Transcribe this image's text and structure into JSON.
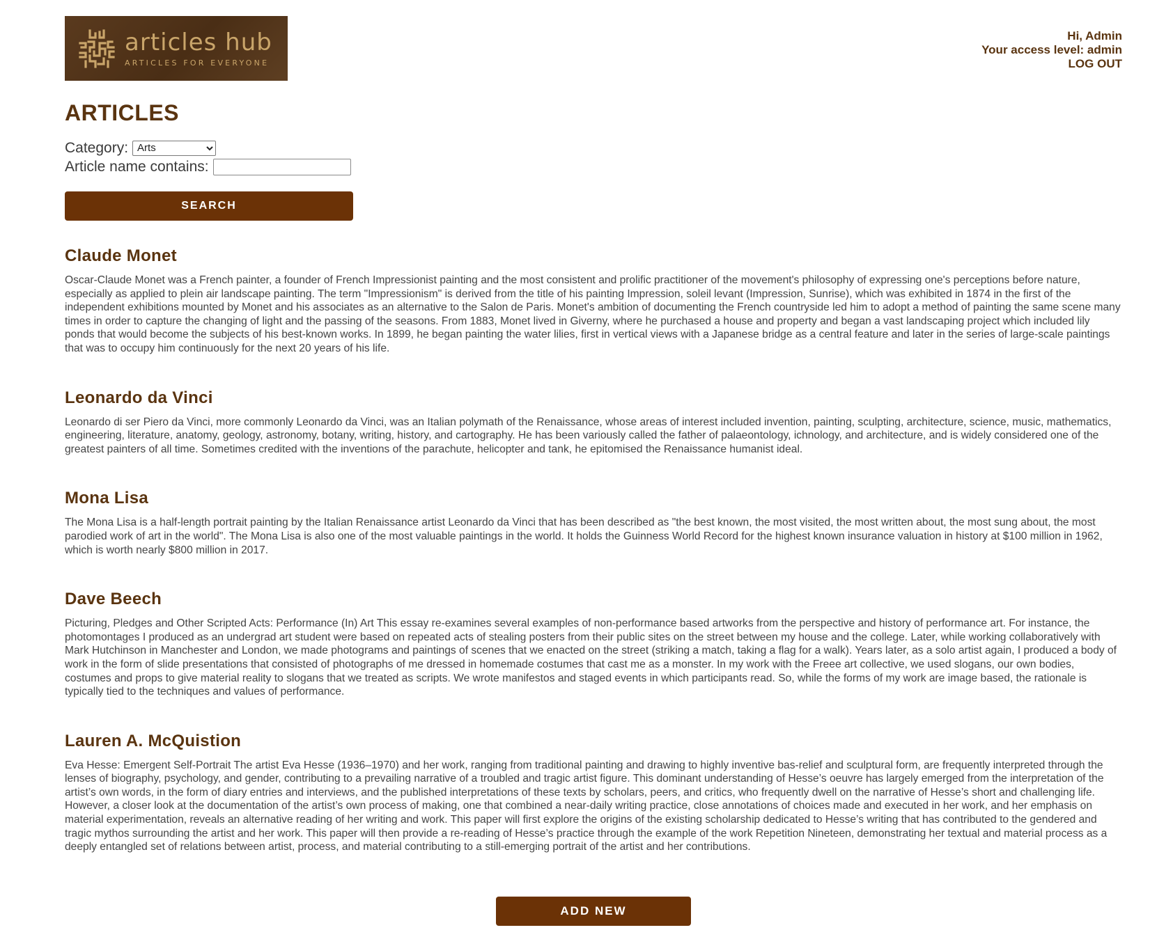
{
  "brand": {
    "title": "articles hub",
    "tagline": "ARTICLES FOR EVERYONE",
    "logo_icon": "maze-knot-icon",
    "colors": {
      "logo_bg": "#4f3119",
      "logo_text": "#c9a56a",
      "accent": "#6b3206",
      "heading": "#5a3410"
    }
  },
  "user": {
    "greeting": "Hi, Admin",
    "access_level": "Your access level: admin",
    "logout_label": "LOG OUT"
  },
  "page": {
    "title": "ARTICLES"
  },
  "filters": {
    "category_label": "Category:",
    "category_selected": "Arts",
    "name_label": "Article name contains:",
    "name_value": "",
    "search_label": "SEARCH"
  },
  "articles": [
    {
      "title": "Claude Monet",
      "body": "Oscar-Claude Monet was a French painter, a founder of French Impressionist painting and the most consistent and prolific practitioner of the movement's philosophy of expressing one's perceptions before nature, especially as applied to plein air landscape painting. The term \"Impressionism\" is derived from the title of his painting Impression, soleil levant (Impression, Sunrise), which was exhibited in 1874 in the first of the independent exhibitions mounted by Monet and his associates as an alternative to the Salon de Paris. Monet's ambition of documenting the French countryside led him to adopt a method of painting the same scene many times in order to capture the changing of light and the passing of the seasons. From 1883, Monet lived in Giverny, where he purchased a house and property and began a vast landscaping project which included lily ponds that would become the subjects of his best-known works. In 1899, he began painting the water lilies, first in vertical views with a Japanese bridge as a central feature and later in the series of large-scale paintings that was to occupy him continuously for the next 20 years of his life."
    },
    {
      "title": "Leonardo da Vinci",
      "body": "Leonardo di ser Piero da Vinci, more commonly Leonardo da Vinci, was an Italian polymath of the Renaissance, whose areas of interest included invention, painting, sculpting, architecture, science, music, mathematics, engineering, literature, anatomy, geology, astronomy, botany, writing, history, and cartography. He has been variously called the father of palaeontology, ichnology, and architecture, and is widely considered one of the greatest painters of all time. Sometimes credited with the inventions of the parachute, helicopter and tank, he epitomised the Renaissance humanist ideal."
    },
    {
      "title": "Mona Lisa",
      "body": "The Mona Lisa is a half-length portrait painting by the Italian Renaissance artist Leonardo da Vinci that has been described as \"the best known, the most visited, the most written about, the most sung about, the most parodied work of art in the world\". The Mona Lisa is also one of the most valuable paintings in the world. It holds the Guinness World Record for the highest known insurance valuation in history at $100 million in 1962, which is worth nearly $800 million in 2017."
    },
    {
      "title": "Dave Beech",
      "body": "Picturing, Pledges and Other Scripted Acts: Performance (In) Art This essay re-examines several examples of non-performance based artworks from the perspective and history of performance art. For instance, the photomontages I produced as an undergrad art student were based on repeated acts of stealing posters from their public sites on the street between my house and the college. Later, while working collaboratively with Mark Hutchinson in Manchester and London, we made photograms and paintings of scenes that we enacted on the street (striking a match, taking a flag for a walk). Years later, as a solo artist again, I produced a body of work in the form of slide presentations that consisted of photographs of me dressed in homemade costumes that cast me as a monster. In my work with the Freee art collective, we used slogans, our own bodies, costumes and props to give material reality to slogans that we treated as scripts. We wrote manifestos and staged events in which participants read. So, while the forms of my work are image based, the rationale is typically tied to the techniques and values of performance."
    },
    {
      "title": "Lauren A. McQuistion",
      "body": "Eva Hesse: Emergent Self-Portrait The artist Eva Hesse (1936–1970) and her work, ranging from traditional painting and drawing to highly inventive bas-relief and sculptural form, are frequently interpreted through the lenses of biography, psychology, and gender, contributing to a prevailing narrative of a troubled and tragic artist figure. This dominant understanding of Hesse’s oeuvre has largely emerged from the interpretation of the artist’s own words, in the form of diary entries and interviews, and the published interpretations of these texts by scholars, peers, and critics, who frequently dwell on the narrative of Hesse’s short and challenging life. However, a closer look at the documentation of the artist’s own process of making, one that combined a near-daily writing practice, close annotations of choices made and executed in her work, and her emphasis on material experimentation, reveals an alternative reading of her writing and work. This paper will first explore the origins of the existing scholarship dedicated to Hesse’s writing that has contributed to the gendered and tragic mythos surrounding the artist and her work. This paper will then provide a re-reading of Hesse’s practice through the example of the work Repetition Nineteen, demonstrating her textual and material process as a deeply entangled set of relations between artist, process, and material contributing to a still-emerging portrait of the artist and her contributions."
    }
  ],
  "actions": {
    "add_new_label": "ADD NEW"
  }
}
